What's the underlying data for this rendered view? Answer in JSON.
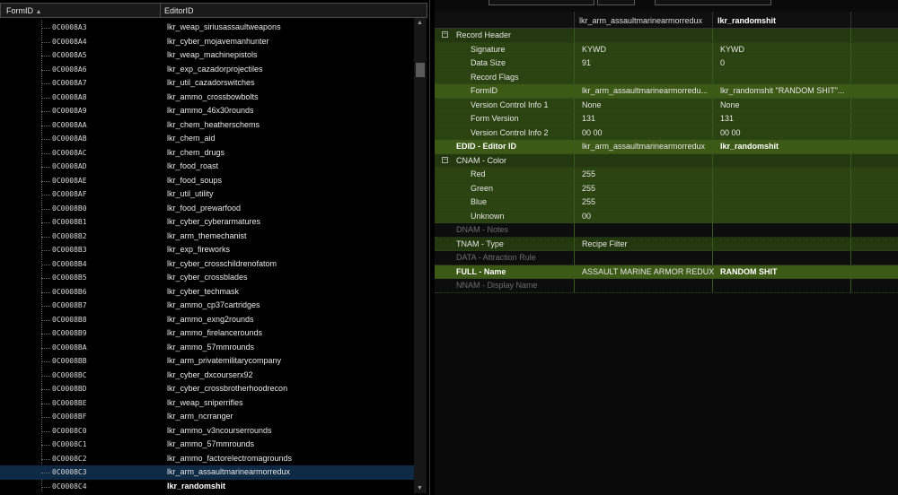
{
  "left_panel": {
    "headers": {
      "form_id": "FormID",
      "sort_indicator": "▲",
      "editor_id": "EditorID"
    },
    "rows": [
      {
        "form_id": "0C0008A3",
        "editor_id": "lkr_weap_siriusassaultweapons"
      },
      {
        "form_id": "0C0008A4",
        "editor_id": "lkr_cyber_mojavemanhunter"
      },
      {
        "form_id": "0C0008A5",
        "editor_id": "lkr_weap_machinepistols"
      },
      {
        "form_id": "0C0008A6",
        "editor_id": "lkr_exp_cazadorprojectiles"
      },
      {
        "form_id": "0C0008A7",
        "editor_id": "lkr_util_cazadorswitches"
      },
      {
        "form_id": "0C0008A8",
        "editor_id": "lkr_ammo_crossbowbolts"
      },
      {
        "form_id": "0C0008A9",
        "editor_id": "lkr_ammo_46x30rounds"
      },
      {
        "form_id": "0C0008AA",
        "editor_id": "lkr_chem_heatherschems"
      },
      {
        "form_id": "0C0008AB",
        "editor_id": "lkr_chem_aid"
      },
      {
        "form_id": "0C0008AC",
        "editor_id": "lkr_chem_drugs"
      },
      {
        "form_id": "0C0008AD",
        "editor_id": "lkr_food_roast"
      },
      {
        "form_id": "0C0008AE",
        "editor_id": "lkr_food_soups"
      },
      {
        "form_id": "0C0008AF",
        "editor_id": "lkr_util_utility"
      },
      {
        "form_id": "0C0008B0",
        "editor_id": "lkr_food_prewarfood"
      },
      {
        "form_id": "0C0008B1",
        "editor_id": "lkr_cyber_cyberarmatures"
      },
      {
        "form_id": "0C0008B2",
        "editor_id": "lkr_arm_themechanist"
      },
      {
        "form_id": "0C0008B3",
        "editor_id": "lkr_exp_fireworks"
      },
      {
        "form_id": "0C0008B4",
        "editor_id": "lkr_cyber_crosschildrenofatom"
      },
      {
        "form_id": "0C0008B5",
        "editor_id": "lkr_cyber_crossblades"
      },
      {
        "form_id": "0C0008B6",
        "editor_id": "lkr_cyber_techmask"
      },
      {
        "form_id": "0C0008B7",
        "editor_id": "lkr_ammo_cp37cartridges"
      },
      {
        "form_id": "0C0008B8",
        "editor_id": "lkr_ammo_exng2rounds"
      },
      {
        "form_id": "0C0008B9",
        "editor_id": "lkr_ammo_firelancerounds"
      },
      {
        "form_id": "0C0008BA",
        "editor_id": "lkr_ammo_57mmrounds"
      },
      {
        "form_id": "0C0008BB",
        "editor_id": "lkr_arm_privatemilitarycompany"
      },
      {
        "form_id": "0C0008BC",
        "editor_id": "lkr_cyber_dxcourserx92"
      },
      {
        "form_id": "0C0008BD",
        "editor_id": "lkr_cyber_crossbrotherhoodrecon"
      },
      {
        "form_id": "0C0008BE",
        "editor_id": "lkr_weap_sniperrifles"
      },
      {
        "form_id": "0C0008BF",
        "editor_id": "lkr_arm_ncrranger"
      },
      {
        "form_id": "0C0008C0",
        "editor_id": "lkr_ammo_v3ncourserrounds"
      },
      {
        "form_id": "0C0008C1",
        "editor_id": "lkr_ammo_57mmrounds"
      },
      {
        "form_id": "0C0008C2",
        "editor_id": "lkr_ammo_factorelectromagrounds"
      },
      {
        "form_id": "0C0008C3",
        "editor_id": "lkr_arm_assaultmarinearmorredux"
      },
      {
        "form_id": "0C0008C4",
        "editor_id": "lkr_randomshit"
      }
    ]
  },
  "right_panel": {
    "columns": {
      "record_a": "lkr_arm_assaultmarinearmorredux",
      "record_b": "lkr_randomshit"
    },
    "rows": [
      {
        "label": "Record Header",
        "indent": 1,
        "expander": "−",
        "a": "",
        "b": ""
      },
      {
        "label": "Signature",
        "indent": 2,
        "a": "KYWD",
        "b": "KYWD"
      },
      {
        "label": "Data Size",
        "indent": 2,
        "a": "91",
        "b": "0"
      },
      {
        "label": "Record Flags",
        "indent": 2,
        "a": "",
        "b": ""
      },
      {
        "label": "FormID",
        "indent": 2,
        "a": "lkr_arm_assaultmarinearmorredu...",
        "b": "lkr_randomshit \"RANDOM SHIT\"..."
      },
      {
        "label": "Version Control Info 1",
        "indent": 2,
        "a": "None",
        "b": "None"
      },
      {
        "label": "Form Version",
        "indent": 2,
        "a": "131",
        "b": "131"
      },
      {
        "label": "Version Control Info 2",
        "indent": 2,
        "a": "00 00",
        "b": "00 00"
      },
      {
        "label": "EDID - Editor ID",
        "indent": 1,
        "a": "lkr_arm_assaultmarinearmorredux",
        "b": "lkr_randomshit"
      },
      {
        "label": "CNAM - Color",
        "indent": 1,
        "expander": "−",
        "a": "",
        "b": ""
      },
      {
        "label": "Red",
        "indent": 2,
        "a": "255",
        "b": ""
      },
      {
        "label": "Green",
        "indent": 2,
        "a": "255",
        "b": ""
      },
      {
        "label": "Blue",
        "indent": 2,
        "a": "255",
        "b": ""
      },
      {
        "label": "Unknown",
        "indent": 2,
        "a": "00",
        "b": ""
      },
      {
        "label": "DNAM - Notes",
        "indent": 1,
        "a": "",
        "b": ""
      },
      {
        "label": "TNAM - Type",
        "indent": 1,
        "a": "Recipe Filter",
        "b": ""
      },
      {
        "label": "DATA - Attraction Rule",
        "indent": 1,
        "a": "",
        "b": ""
      },
      {
        "label": "FULL - Name",
        "indent": 1,
        "a": "ASSAULT MARINE ARMOR REDUX",
        "b": "RANDOM SHIT"
      },
      {
        "label": "NNAM - Display Name",
        "indent": 1,
        "a": "",
        "b": ""
      }
    ]
  }
}
